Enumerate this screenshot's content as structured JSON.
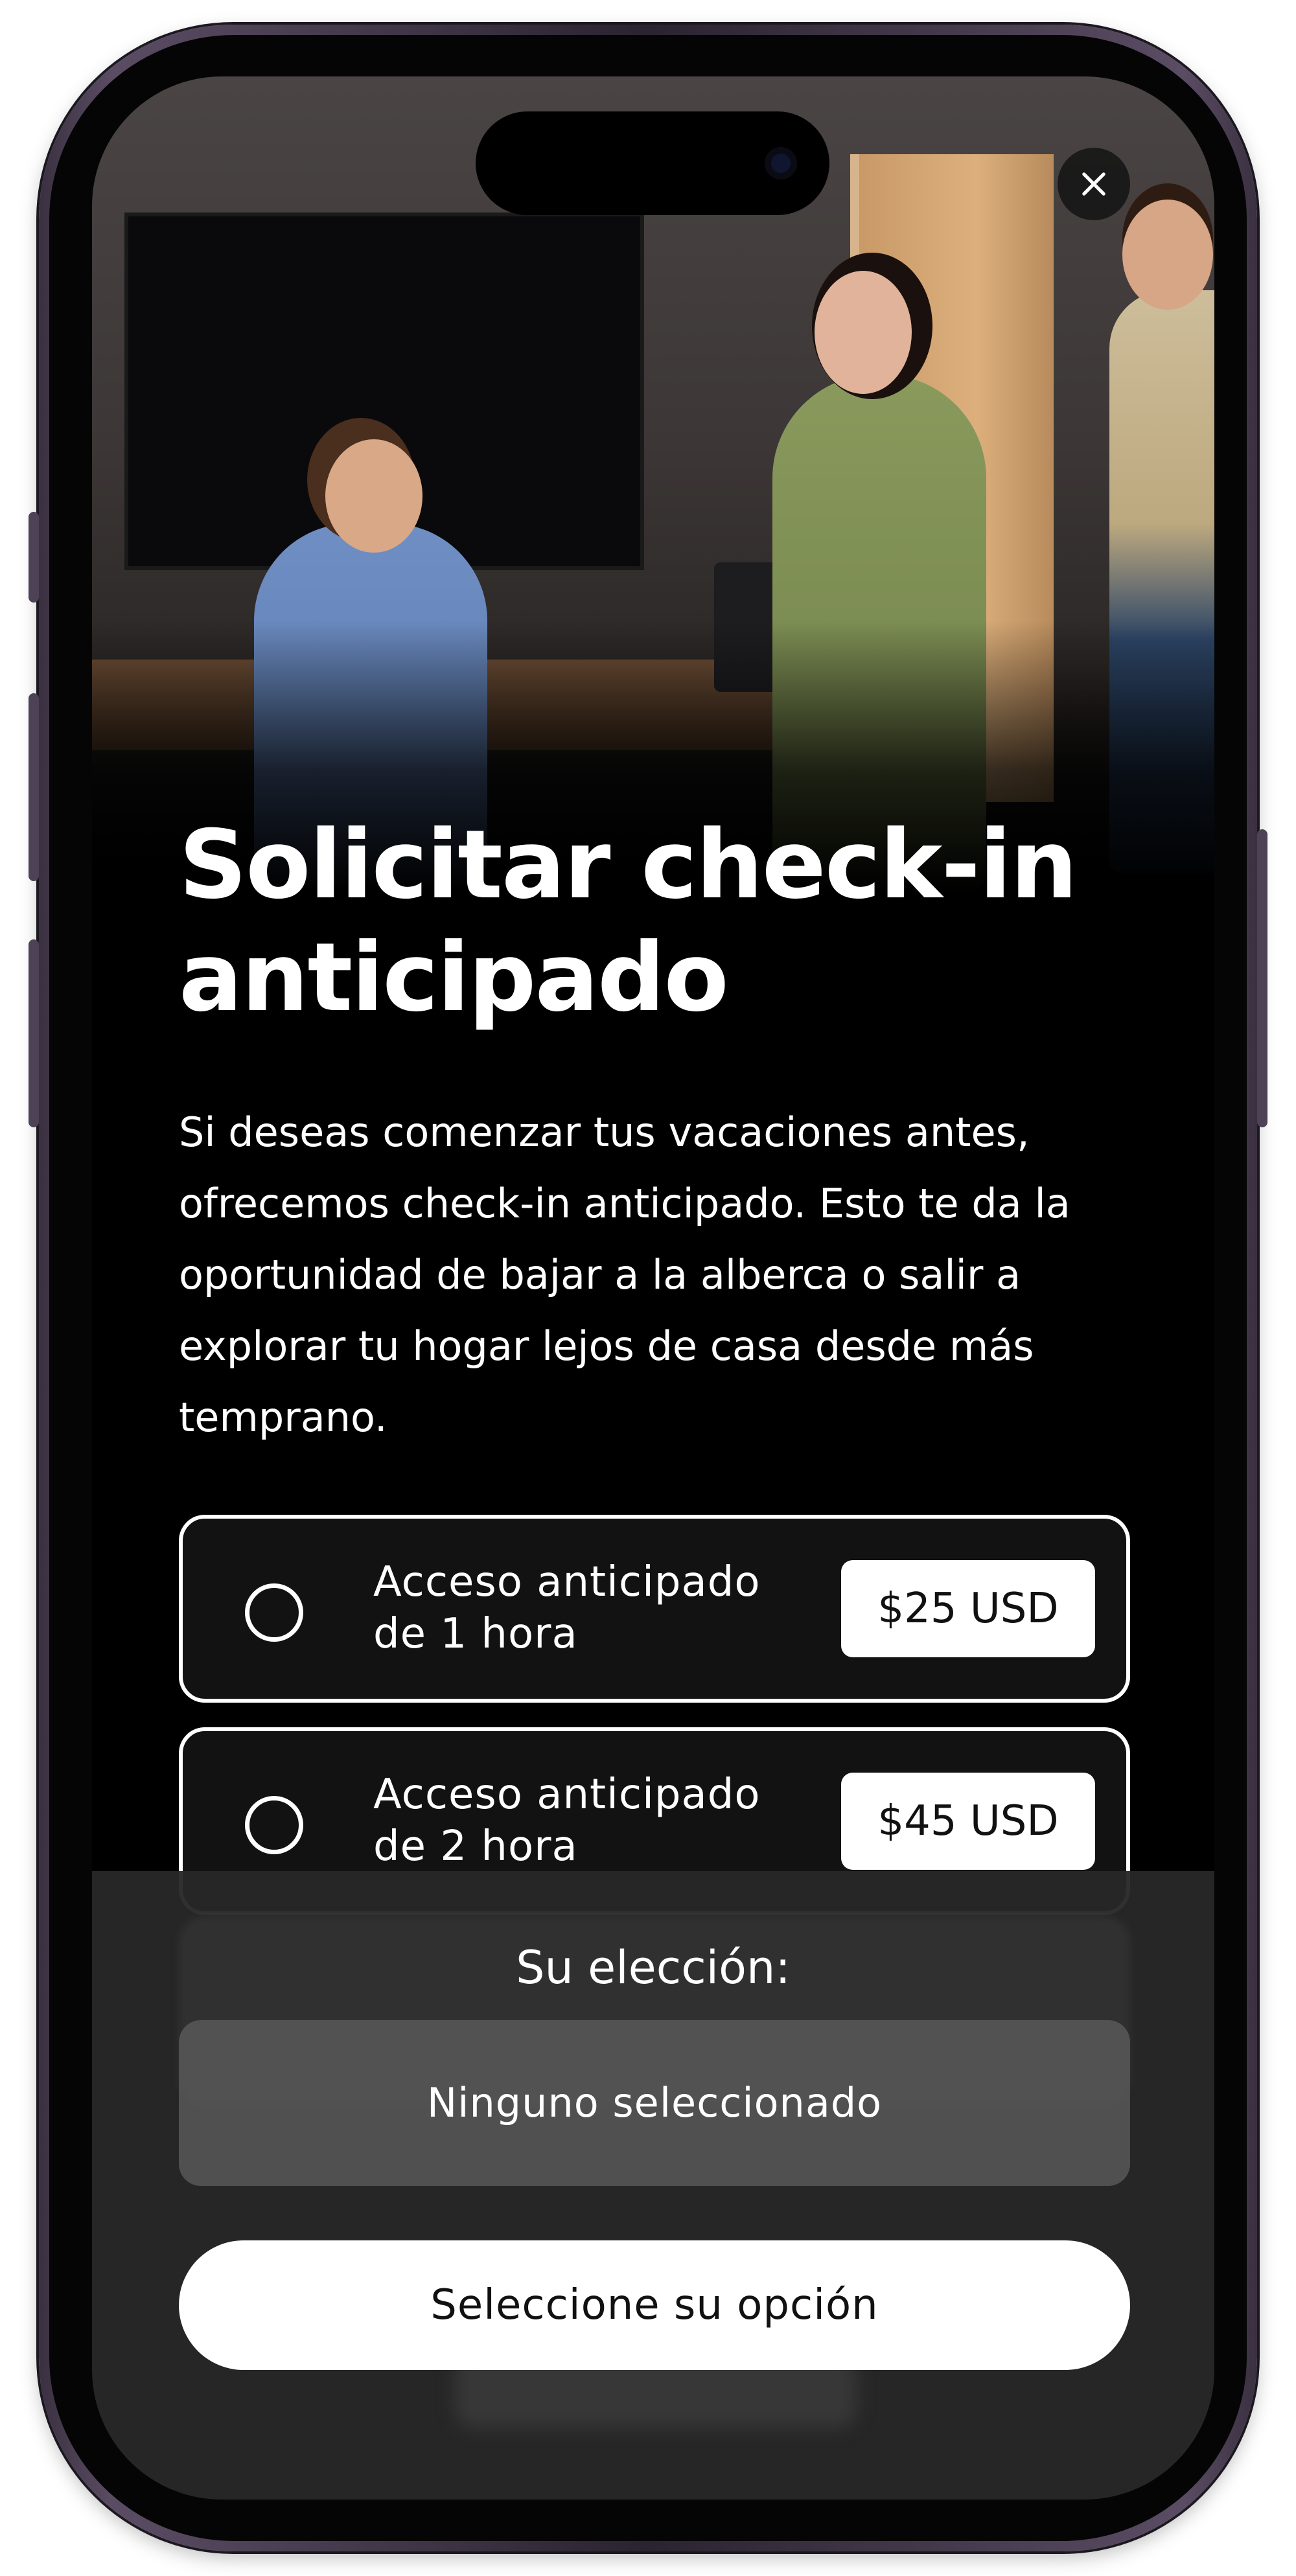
{
  "header": {
    "close_icon": "close-icon"
  },
  "content": {
    "title": "Solicitar check-in anticipado",
    "description": "Si deseas comenzar tus vacaciones antes, ofrecemos check-in anticipado. Esto te da la oportunidad de bajar a la alberca o salir a explorar tu hogar lejos de casa desde más temprano."
  },
  "options": [
    {
      "label": "Acceso anticipado de 1 hora",
      "price": "$25 USD",
      "selected": false
    },
    {
      "label": "Acceso anticipado de 2 hora",
      "price": "$45 USD",
      "selected": false
    }
  ],
  "selection": {
    "label": "Su elección:",
    "value": "Ninguno seleccionado"
  },
  "cta": {
    "label": "Seleccione su opción"
  },
  "colors": {
    "background": "#000000",
    "text": "#ffffff",
    "sheet": "#282828",
    "button": "#ffffff"
  }
}
